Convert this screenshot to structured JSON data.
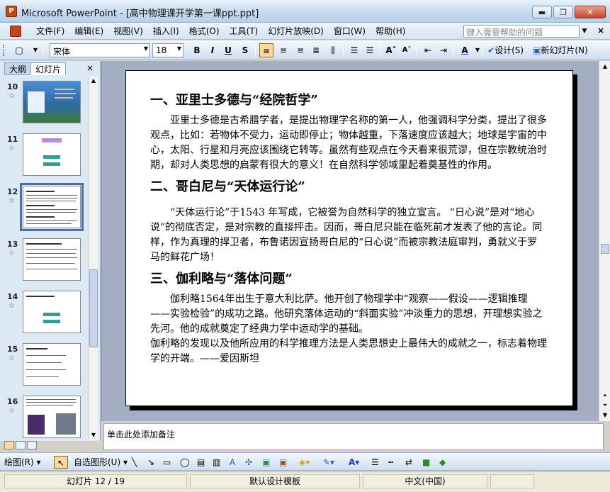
{
  "window": {
    "title": "Microsoft PowerPoint - [高中物理课开学第一课ppt.ppt]",
    "minimize": "▬",
    "restore": "❐",
    "close": "✕"
  },
  "menubar": {
    "items": [
      "文件(F)",
      "编辑(E)",
      "视图(V)",
      "插入(I)",
      "格式(O)",
      "工具(T)",
      "幻灯片放映(D)",
      "窗口(W)",
      "帮助(H)"
    ],
    "help_placeholder": "键入需要帮助的问题",
    "close": "×"
  },
  "toolbar": {
    "font": "宋体",
    "size": "18",
    "bold": "B",
    "italic": "I",
    "underline": "U",
    "shadow": "S",
    "design": "设计(S)",
    "new_slide": "新幻灯片(N)"
  },
  "panel": {
    "tabs": [
      "大纲",
      "幻灯片"
    ],
    "close": "×",
    "thumb_numbers": [
      "10",
      "11",
      "12",
      "13",
      "14",
      "15",
      "16"
    ],
    "selected_index": 2
  },
  "slide": {
    "sections": [
      {
        "heading": "一、亚里士多德与“经院哲学”",
        "paragraphs": [
          "亚里士多德是古希腊学者，是提出物理学名称的第一人，他强调科学分类，提出了很多观点，比如：若物体不受力，运动即停止；物体越重，下落速度应该越大；地球是宇宙的中心，太阳、行星和月亮应该围绕它转等。虽然有些观点在今天看来很荒谬，但在宗教统治时期，却对人类思想的启蒙有很大的意义！在自然科学领域里起着奠基性的作用。"
        ]
      },
      {
        "heading": "二、哥白尼与“天体运行论”",
        "paragraphs": [
          "“天体运行论”于1543 年写成，它被誉为自然科学的独立宣言。 “日心说”是对“地心说”的彻底否定，是对宗教的直接抨击。因而，哥白尼只能在临死前才发表了他的言论。同样，作为真理的捍卫者，布鲁诺因宣扬哥白尼的“日心说”而被宗教法庭审判，勇就义于罗马的鲜花广场！"
        ]
      },
      {
        "heading": "三、伽利略与“落体问题”",
        "paragraphs": [
          "伽利略1564年出生于意大利比萨。他开创了物理学中“观察——假设——逻辑推理——实验检验”的成功之路。他研究落体运动的“斜面实验”冲淡重力的思想，开理想实验之先河。他的成就奠定了经典力学中运动学的基础。"
        ],
        "tail": "伽利略的发现以及他所应用的科学推理方法是人类思想史上最伟大的成就之一，标志着物理学的开端。——爱因斯坦"
      }
    ]
  },
  "notes": {
    "placeholder": "单击此处添加备注"
  },
  "drawbar": {
    "draw": "绘图(R)",
    "autoshapes": "自选图形(U)"
  },
  "status": {
    "slide": "幻灯片 12 / 19",
    "template": "默认设计模板",
    "language": "中文(中国)"
  }
}
